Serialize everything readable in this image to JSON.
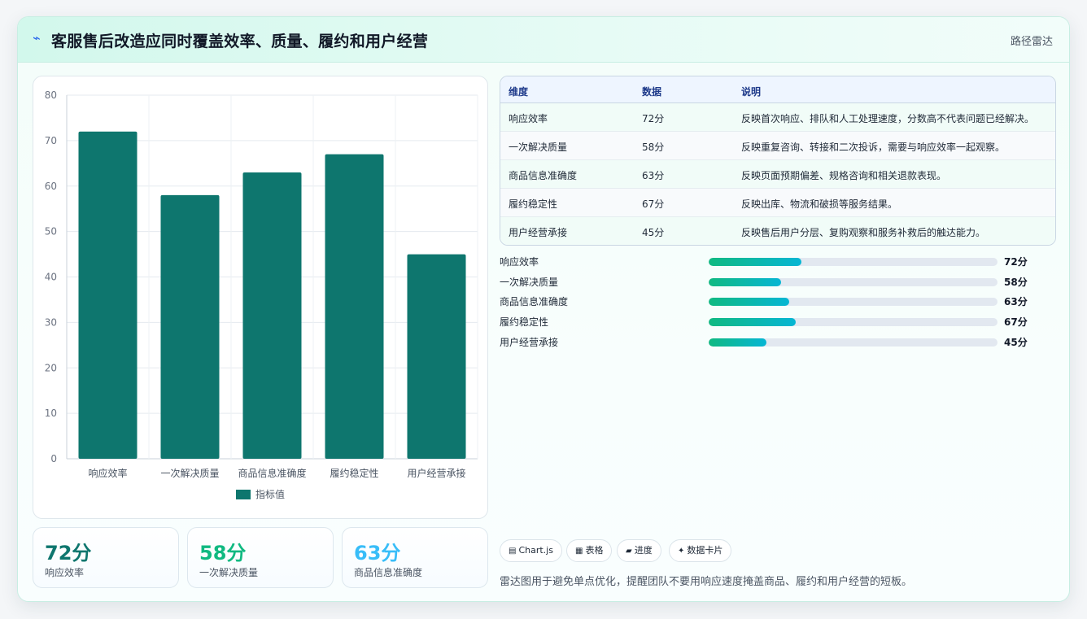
{
  "header": {
    "icon": "lightning-icon",
    "title": "客服售后改造应同时覆盖效率、质量、履约和用户经营",
    "tag": "路径雷达"
  },
  "chart_data": {
    "type": "bar",
    "categories": [
      "响应效率",
      "一次解决质量",
      "商品信息准确度",
      "履约稳定性",
      "用户经营承接"
    ],
    "series": [
      {
        "name": "指标值",
        "values": [
          72,
          58,
          63,
          67,
          45
        ],
        "color": "#0e766e"
      }
    ],
    "ylim": [
      0,
      80
    ],
    "yticks": [
      0,
      10,
      20,
      30,
      40,
      50,
      60,
      70,
      80
    ],
    "grid": true,
    "legend": "bottom"
  },
  "stats": [
    {
      "value": "72分",
      "label": "响应效率",
      "color": "#0e766e"
    },
    {
      "value": "58分",
      "label": "一次解决质量",
      "color": "#10b981"
    },
    {
      "value": "63分",
      "label": "商品信息准确度",
      "color": "#38bdf8"
    }
  ],
  "table": {
    "headers": [
      "维度",
      "数据",
      "说明"
    ],
    "rows": [
      [
        "响应效率",
        "72分",
        "反映首次响应、排队和人工处理速度，分数高不代表问题已经解决。"
      ],
      [
        "一次解决质量",
        "58分",
        "反映重复咨询、转接和二次投诉，需要与响应效率一起观察。"
      ],
      [
        "商品信息准确度",
        "63分",
        "反映页面预期偏差、规格咨询和相关退款表现。"
      ],
      [
        "履约稳定性",
        "67分",
        "反映出库、物流和破损等服务结果。"
      ],
      [
        "用户经营承接",
        "45分",
        "反映售后用户分层、复购观察和服务补救后的触达能力。"
      ]
    ]
  },
  "progress": [
    {
      "label": "响应效率",
      "value": "72分",
      "percent": 32
    },
    {
      "label": "一次解决质量",
      "value": "58分",
      "percent": 25
    },
    {
      "label": "商品信息准确度",
      "value": "63分",
      "percent": 28
    },
    {
      "label": "履约稳定性",
      "value": "67分",
      "percent": 30
    },
    {
      "label": "用户经营承接",
      "value": "45分",
      "percent": 20
    }
  ],
  "chips": [
    {
      "icon": "▤",
      "label": "Chart.js"
    },
    {
      "icon": "▦",
      "label": "表格"
    },
    {
      "icon": "▰",
      "label": "进度"
    },
    {
      "icon": "✦",
      "label": "数据卡片"
    }
  ],
  "footnote": "雷达图用于避免单点优化，提醒团队不要用响应速度掩盖商品、履约和用户经营的短板。"
}
